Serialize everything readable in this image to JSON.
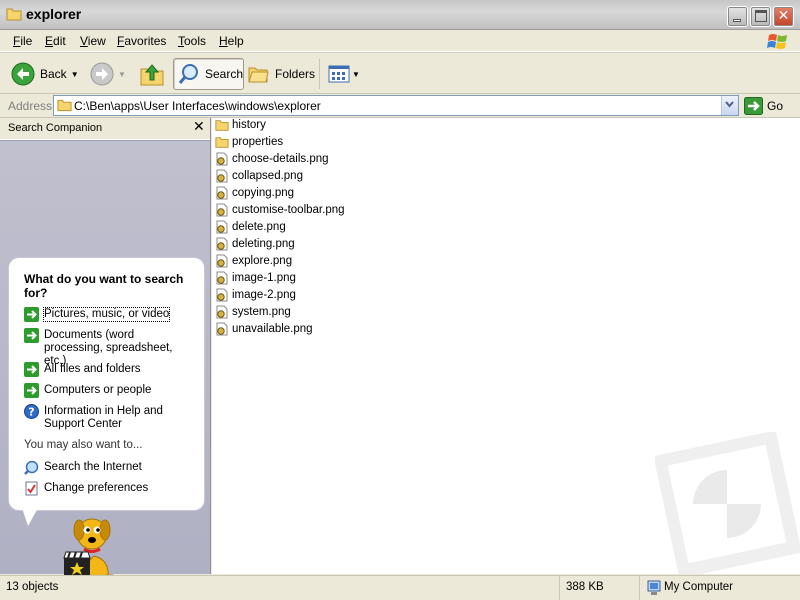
{
  "window": {
    "title": "explorer"
  },
  "menu": {
    "items": [
      {
        "label": "File",
        "underline": "F",
        "rest": "ile"
      },
      {
        "label": "Edit",
        "underline": "E",
        "rest": "dit"
      },
      {
        "label": "View",
        "underline": "V",
        "rest": "iew"
      },
      {
        "label": "Favorites",
        "underline": "F",
        "rest": "avorites",
        "prefix": ""
      },
      {
        "label": "Tools",
        "underline": "T",
        "rest": "ools"
      },
      {
        "label": "Help",
        "underline": "H",
        "rest": "elp"
      }
    ]
  },
  "toolbar": {
    "back_label": "Back",
    "search_label": "Search",
    "folders_label": "Folders"
  },
  "address": {
    "label": "Address",
    "path": "C:\\Ben\\apps\\User Interfaces\\windows\\explorer",
    "go_label": "Go"
  },
  "search_pane": {
    "title": "Search Companion",
    "question": "What do you want to search for?",
    "options": [
      {
        "label": "Pictures, music, or video",
        "icon": "arrow-icon"
      },
      {
        "label": "Documents (word processing, spreadsheet, etc.)",
        "icon": "arrow-icon"
      },
      {
        "label": "All files and folders",
        "icon": "arrow-icon"
      },
      {
        "label": "Computers or people",
        "icon": "arrow-icon"
      },
      {
        "label": "Information in Help and Support Center",
        "icon": "help-icon"
      }
    ],
    "also_text": "You may also want to...",
    "also_options": [
      {
        "label": "Search the Internet",
        "icon": "internet-search-icon"
      },
      {
        "label": "Change preferences",
        "icon": "preferences-icon"
      }
    ]
  },
  "files": [
    {
      "name": "history",
      "type": "folder"
    },
    {
      "name": "properties",
      "type": "folder"
    },
    {
      "name": "choose-details.png",
      "type": "png"
    },
    {
      "name": "collapsed.png",
      "type": "png"
    },
    {
      "name": "copying.png",
      "type": "png"
    },
    {
      "name": "customise-toolbar.png",
      "type": "png"
    },
    {
      "name": "delete.png",
      "type": "png"
    },
    {
      "name": "deleting.png",
      "type": "png"
    },
    {
      "name": "explore.png",
      "type": "png"
    },
    {
      "name": "image-1.png",
      "type": "png"
    },
    {
      "name": "image-2.png",
      "type": "png"
    },
    {
      "name": "system.png",
      "type": "png"
    },
    {
      "name": "unavailable.png",
      "type": "png"
    }
  ],
  "status": {
    "objects": "13 objects",
    "size": "388 KB",
    "location": "My Computer"
  },
  "colors": {
    "title_bg": "#C6C6C6",
    "pane_bg": "#B0B0C4",
    "address_border": "#7F9DB9",
    "go_green": "#3A9A3A"
  }
}
